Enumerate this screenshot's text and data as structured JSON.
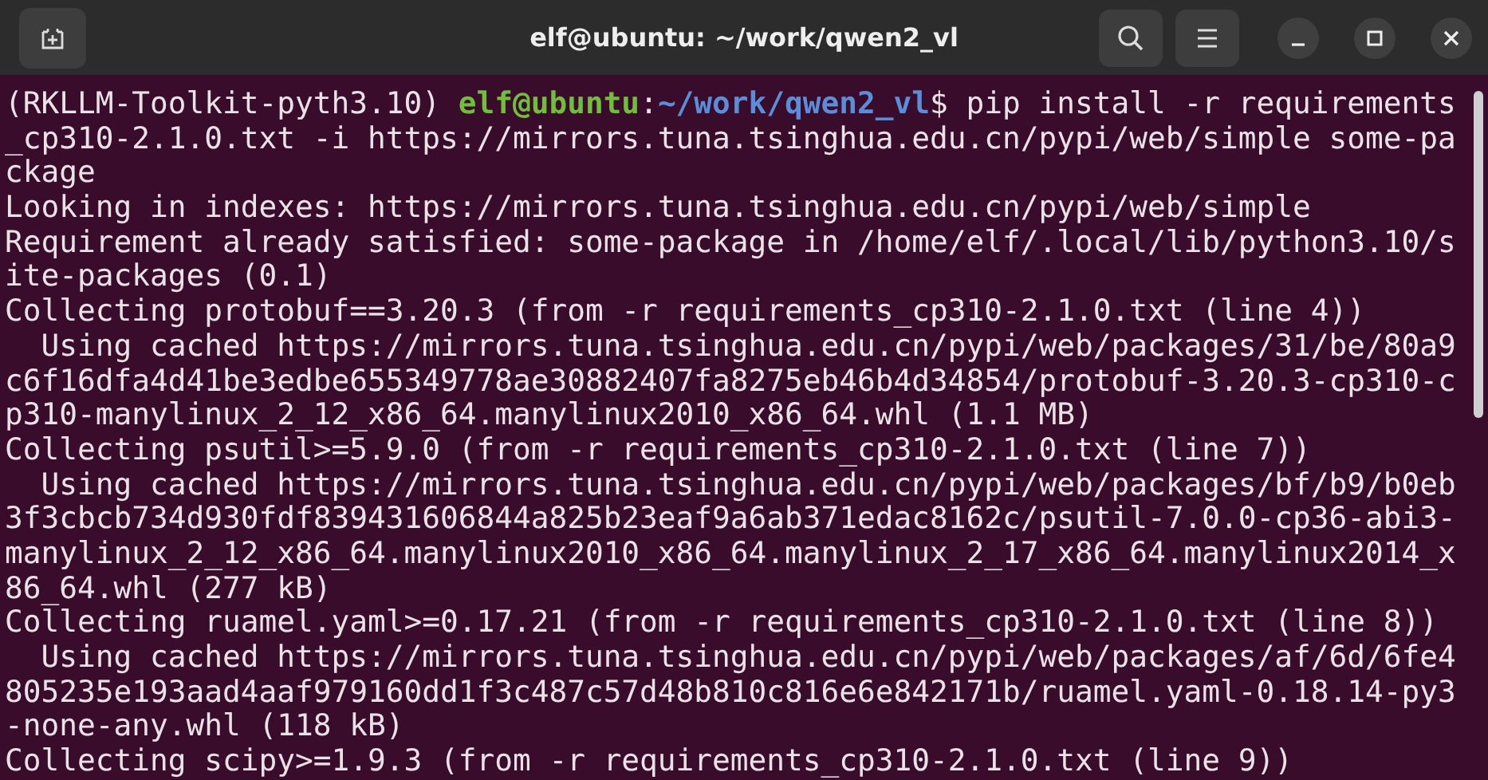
{
  "window": {
    "title": "elf@ubuntu: ~/work/qwen2_vl"
  },
  "terminal": {
    "lines": [
      {
        "kind": "prompt",
        "segments": [
          {
            "kind": "plain",
            "text": "(RKLLM-Toolkit-pyth3.10) "
          },
          {
            "kind": "user",
            "text": "elf@ubuntu"
          },
          {
            "kind": "plain",
            "text": ":"
          },
          {
            "kind": "path",
            "text": "~/work/qwen2_vl"
          },
          {
            "kind": "plain",
            "text": "$ pip install -r requirements"
          }
        ]
      },
      {
        "kind": "output",
        "text": "_cp310-2.1.0.txt -i https://mirrors.tuna.tsinghua.edu.cn/pypi/web/simple some-pa"
      },
      {
        "kind": "output",
        "text": "ckage"
      },
      {
        "kind": "output",
        "text": "Looking in indexes: https://mirrors.tuna.tsinghua.edu.cn/pypi/web/simple"
      },
      {
        "kind": "output",
        "text": "Requirement already satisfied: some-package in /home/elf/.local/lib/python3.10/s"
      },
      {
        "kind": "output",
        "text": "ite-packages (0.1)"
      },
      {
        "kind": "output",
        "text": "Collecting protobuf==3.20.3 (from -r requirements_cp310-2.1.0.txt (line 4))"
      },
      {
        "kind": "output",
        "text": "  Using cached https://mirrors.tuna.tsinghua.edu.cn/pypi/web/packages/31/be/80a9"
      },
      {
        "kind": "output",
        "text": "c6f16dfa4d41be3edbe655349778ae30882407fa8275eb46b4d34854/protobuf-3.20.3-cp310-c"
      },
      {
        "kind": "output",
        "text": "p310-manylinux_2_12_x86_64.manylinux2010_x86_64.whl (1.1 MB)"
      },
      {
        "kind": "output",
        "text": "Collecting psutil>=5.9.0 (from -r requirements_cp310-2.1.0.txt (line 7))"
      },
      {
        "kind": "output",
        "text": "  Using cached https://mirrors.tuna.tsinghua.edu.cn/pypi/web/packages/bf/b9/b0eb"
      },
      {
        "kind": "output",
        "text": "3f3cbcb734d930fdf839431606844a825b23eaf9a6ab371edac8162c/psutil-7.0.0-cp36-abi3-"
      },
      {
        "kind": "output",
        "text": "manylinux_2_12_x86_64.manylinux2010_x86_64.manylinux_2_17_x86_64.manylinux2014_x"
      },
      {
        "kind": "output",
        "text": "86_64.whl (277 kB)"
      },
      {
        "kind": "output",
        "text": "Collecting ruamel.yaml>=0.17.21 (from -r requirements_cp310-2.1.0.txt (line 8))"
      },
      {
        "kind": "output",
        "text": "  Using cached https://mirrors.tuna.tsinghua.edu.cn/pypi/web/packages/af/6d/6fe4"
      },
      {
        "kind": "output",
        "text": "805235e193aad4aaf979160dd1f3c487c57d48b810c816e6e842171b/ruamel.yaml-0.18.14-py3"
      },
      {
        "kind": "output",
        "text": "-none-any.whl (118 kB)"
      },
      {
        "kind": "output",
        "text": "Collecting scipy>=1.9.3 (from -r requirements_cp310-2.1.0.txt (line 9))"
      }
    ]
  }
}
